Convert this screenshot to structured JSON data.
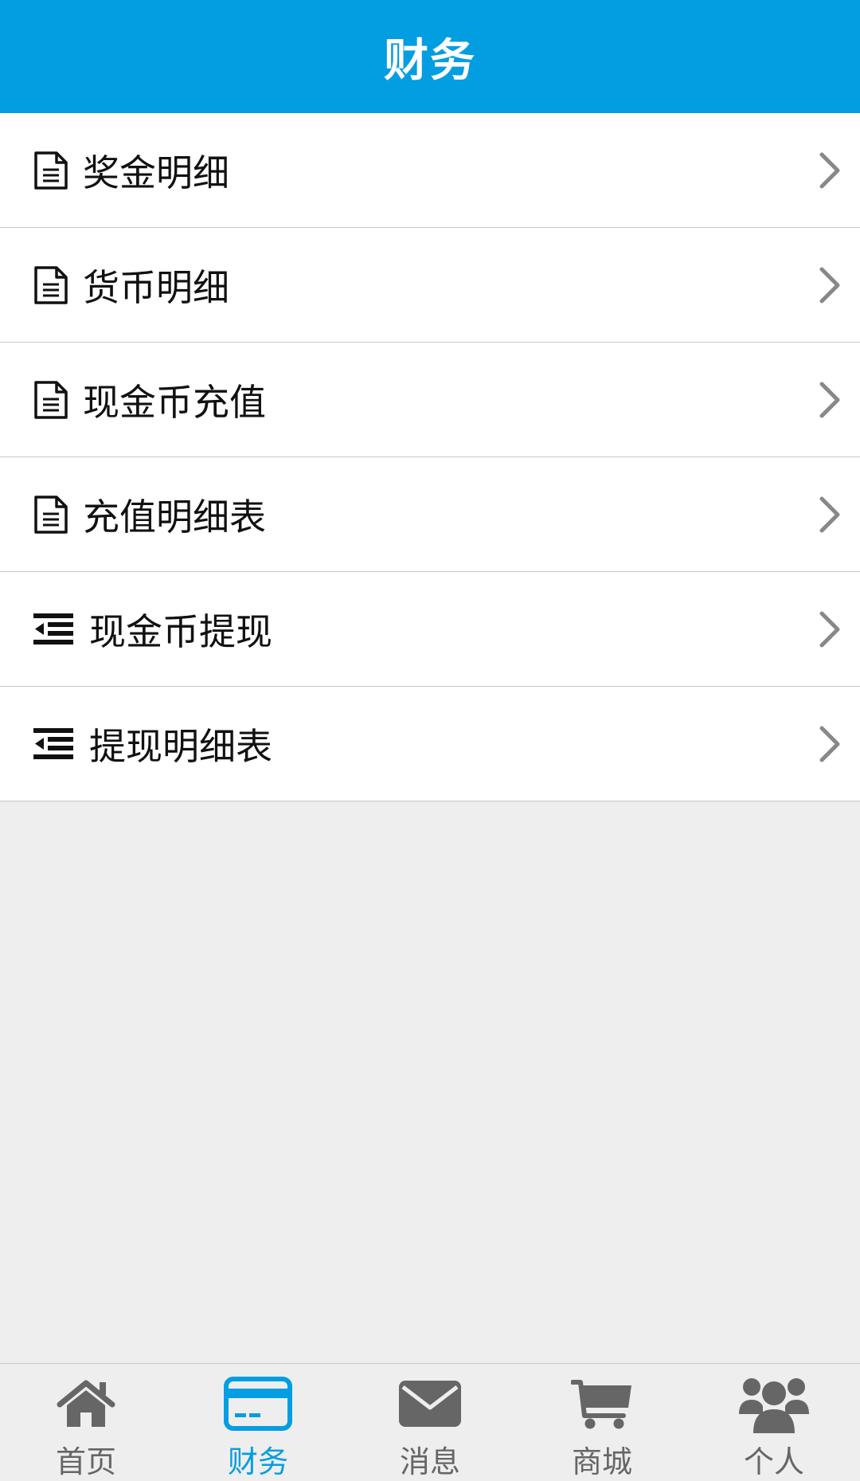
{
  "header": {
    "title": "财务"
  },
  "menu": {
    "items": [
      {
        "label": "奖金明细",
        "icon": "document-icon"
      },
      {
        "label": "货币明细",
        "icon": "document-icon"
      },
      {
        "label": "现金币充值",
        "icon": "document-icon"
      },
      {
        "label": "充值明细表",
        "icon": "document-icon"
      },
      {
        "label": "现金币提现",
        "icon": "indent-list-icon"
      },
      {
        "label": "提现明细表",
        "icon": "indent-list-icon"
      }
    ]
  },
  "tabbar": {
    "active_index": 1,
    "items": [
      {
        "label": "首页",
        "icon": "home-icon"
      },
      {
        "label": "财务",
        "icon": "credit-card-icon"
      },
      {
        "label": "消息",
        "icon": "envelope-icon"
      },
      {
        "label": "商城",
        "icon": "shopping-cart-icon"
      },
      {
        "label": "个人",
        "icon": "users-icon"
      }
    ]
  },
  "colors": {
    "brand": "#039de2",
    "background": "#eeeeee",
    "tab_inactive": "#666666"
  }
}
